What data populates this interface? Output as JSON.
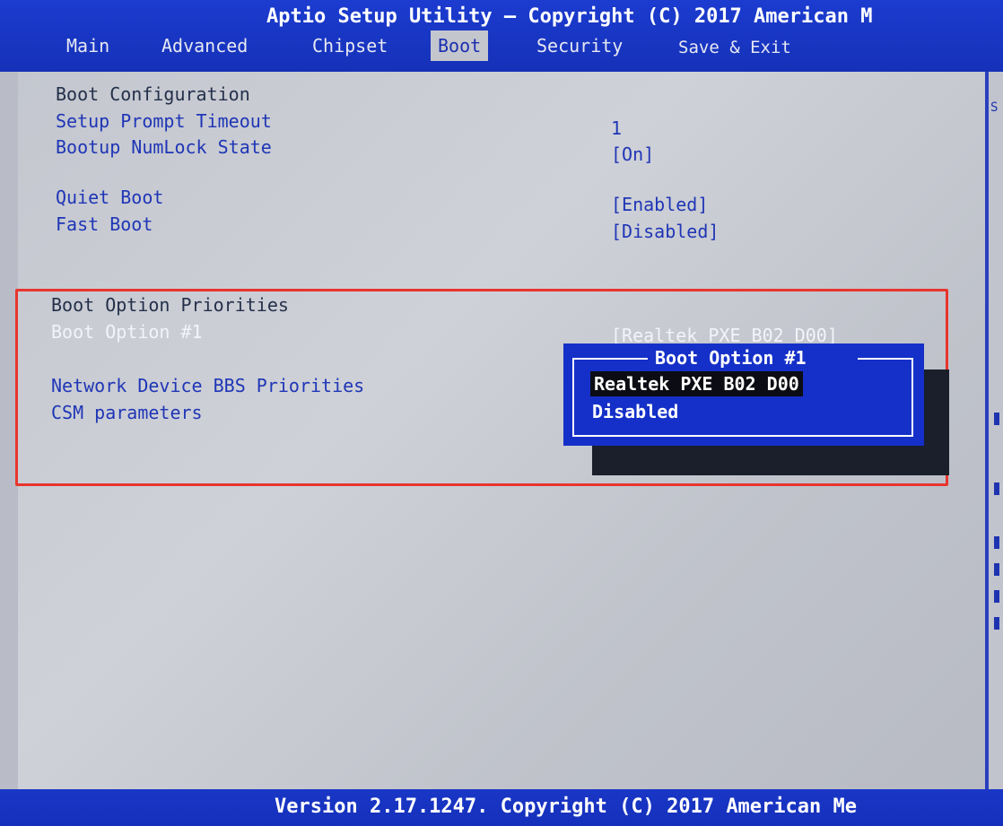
{
  "header": {
    "title": "Aptio Setup Utility – Copyright (C) 2017 American M"
  },
  "tabs": [
    {
      "label": "Main"
    },
    {
      "label": "Advanced"
    },
    {
      "label": "Chipset"
    },
    {
      "label": "Boot",
      "active": true
    },
    {
      "label": "Security"
    },
    {
      "label": "Save & Exit"
    }
  ],
  "settings": {
    "boot_configuration": "Boot Configuration",
    "setup_prompt_timeout": {
      "label": "Setup Prompt Timeout",
      "value": "1"
    },
    "bootup_numlock": {
      "label": "Bootup NumLock State",
      "value": "[On]"
    },
    "quiet_boot": {
      "label": "Quiet Boot",
      "value": "[Enabled]"
    },
    "fast_boot": {
      "label": "Fast Boot",
      "value": "[Disabled]"
    },
    "boot_option_priorities": "Boot Option Priorities",
    "boot_option_1": {
      "label": "Boot Option #1",
      "value": "[Realtek PXE B02 D00]"
    },
    "network_bbs": "Network Device BBS Priorities",
    "csm_parameters": "CSM parameters"
  },
  "popup": {
    "title": "Boot Option #1",
    "options": [
      {
        "label": "Realtek PXE B02 D00",
        "selected": true
      },
      {
        "label": "Disabled",
        "selected": false
      }
    ]
  },
  "help_panel": {
    "text_fragment": "S"
  },
  "footer": {
    "version": "Version 2.17.1247. Copyright (C) 2017 American Me"
  },
  "colors": {
    "header_blue": "#1c3cd0",
    "text_blue": "#1f36b6",
    "highlight_red": "#e8352d",
    "popup_blue": "#1530c8"
  }
}
